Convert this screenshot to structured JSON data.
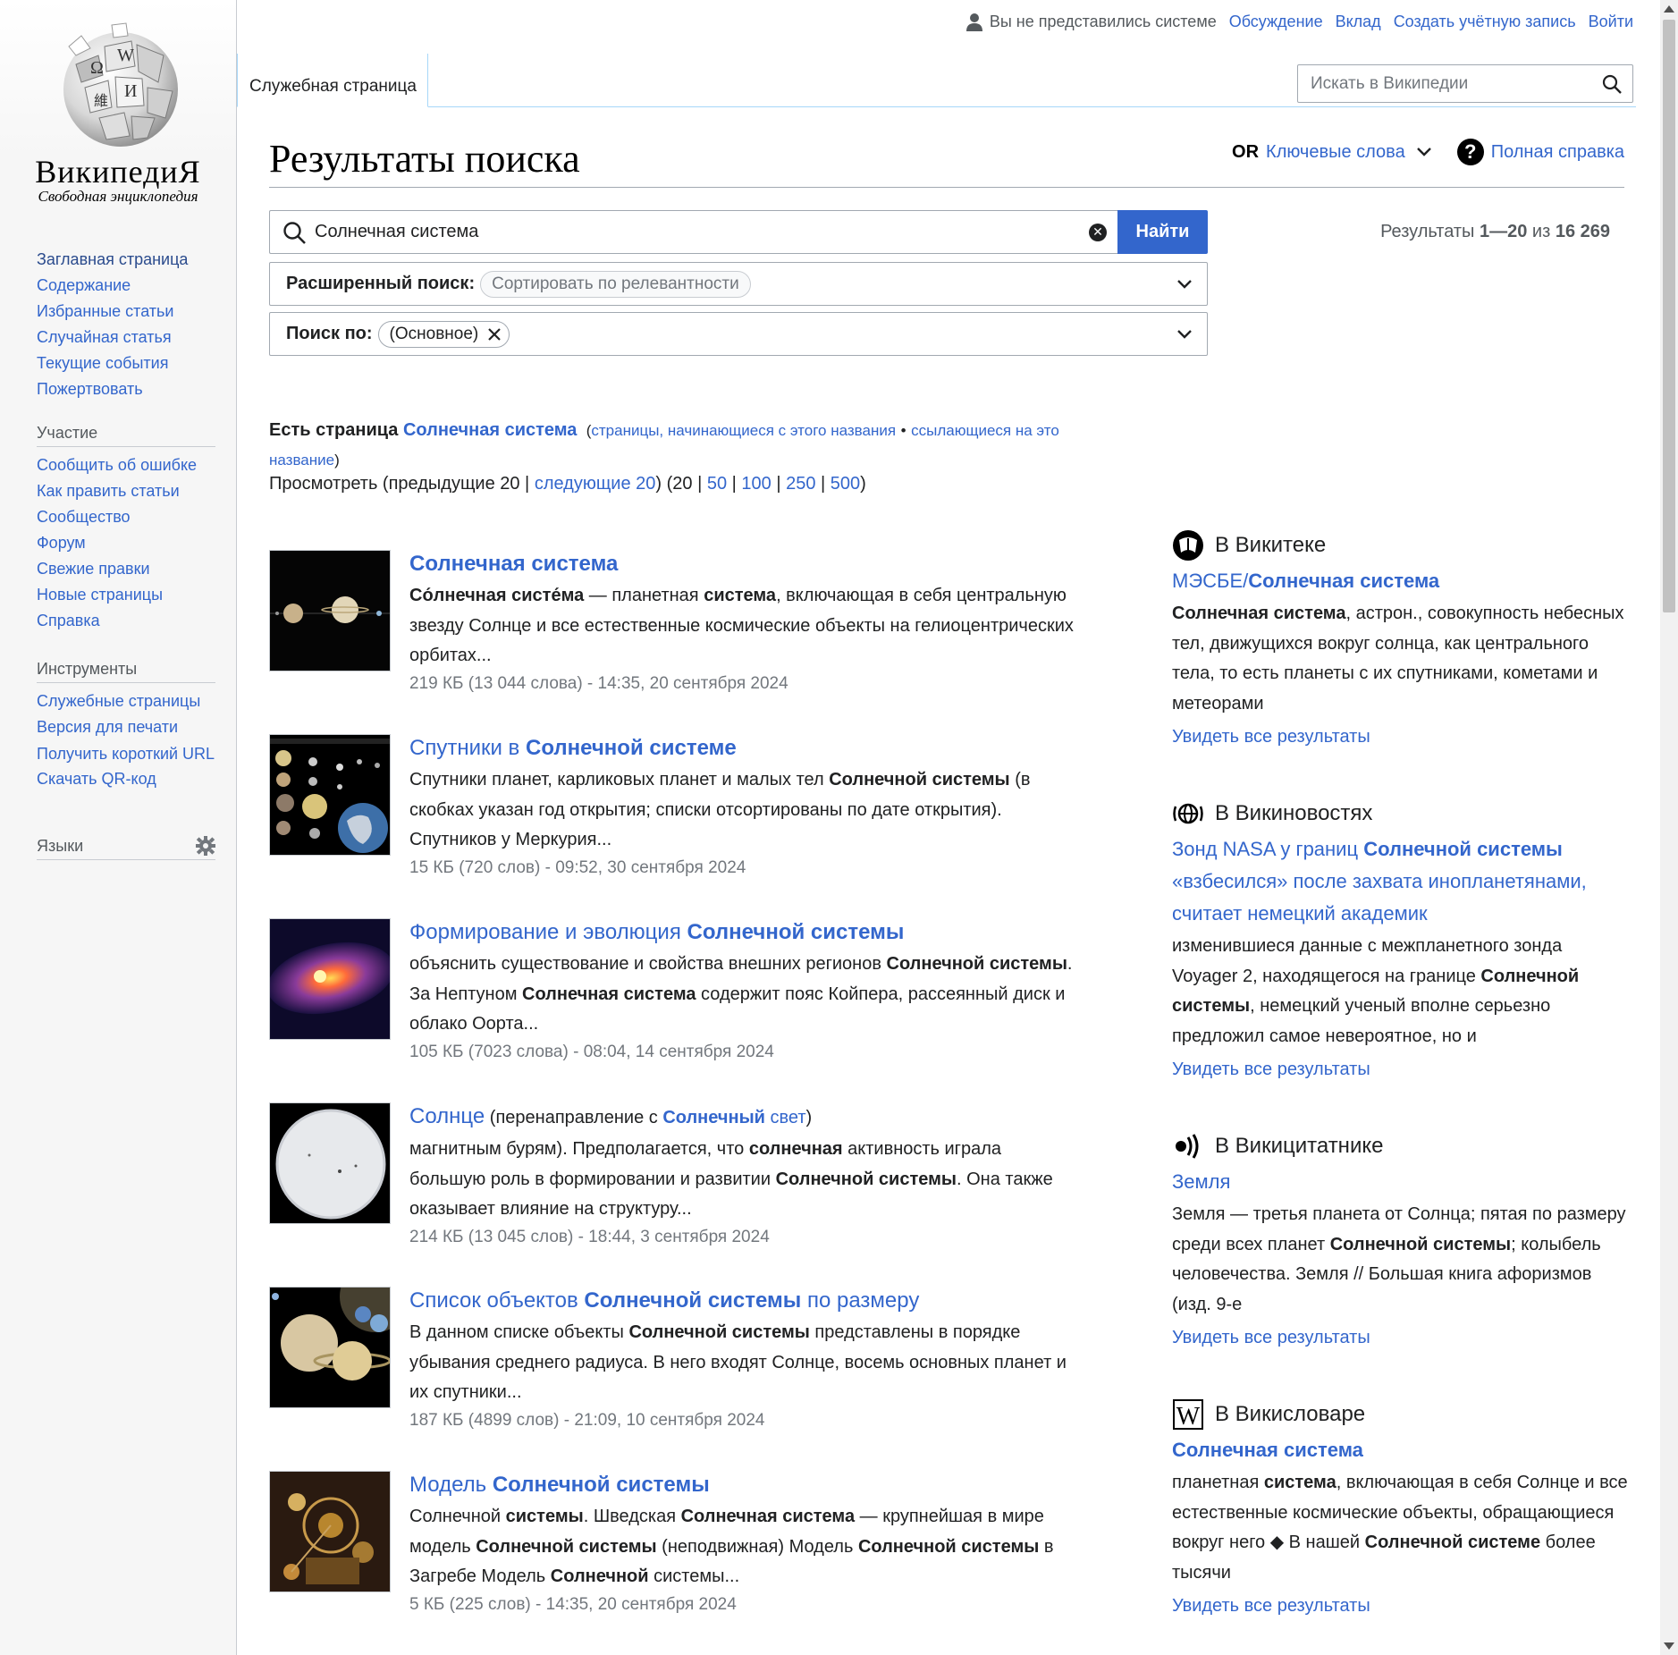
{
  "site": {
    "wordmark": "ВикипедиЯ",
    "tagline": "Свободная энциклопедия",
    "globe_letters": [
      "Ω",
      "W",
      "И",
      "維"
    ]
  },
  "header": {
    "anon_text": "Вы не представились системе",
    "links": [
      "Обсуждение",
      "Вклад",
      "Создать учётную запись",
      "Войти"
    ],
    "tab_special": "Служебная страница",
    "search_placeholder": "Искать в Википедии"
  },
  "sidebar": {
    "main": [
      "Заглавная страница",
      "Содержание",
      "Избранные статьи",
      "Случайная статья",
      "Текущие события",
      "Пожертвовать"
    ],
    "participation_heading": "Участие",
    "participation": [
      "Сообщить об ошибке",
      "Как править статьи",
      "Сообщество",
      "Форум",
      "Свежие правки",
      "Новые страницы",
      "Справка"
    ],
    "tools_heading": "Инструменты",
    "tools": [
      "Служебные страницы",
      "Версия для печати",
      "Получить короткий URL",
      "Скачать QR-код"
    ],
    "languages_heading": "Языки"
  },
  "page": {
    "title": "Результаты поиска",
    "or_label": "OR",
    "keywords_label": "Ключевые слова",
    "help_label": "Полная справка",
    "help_icon_glyph": "?",
    "query": "Солнечная система",
    "find_button": "Найти",
    "results_prefix": "Результаты",
    "results_range": "1—20",
    "results_of": "из",
    "results_total": "16 269",
    "advanced_label": "Расширенный поиск:",
    "advanced_chip": "Сортировать по релевантности",
    "search_in_label": "Поиск по:",
    "search_in_chip": "(Основное)",
    "exists_prefix": "Есть страница",
    "exists_link": "Солнечная система",
    "exists_sub1": "страницы, начинающиеся с этого названия",
    "exists_sep": "•",
    "exists_sub2": "ссылающиеся на это название",
    "view_prefix": "Просмотреть (предыдущие 20 |",
    "view_next": "следующие 20",
    "view_counts": [
      "50",
      "100",
      "250",
      "500"
    ],
    "view_current": "20"
  },
  "results": [
    {
      "title_parts": [
        {
          "t": "Солнечная система",
          "b": true
        }
      ],
      "snippet": "<b>Со́лнечная систе́ма</b> — планетная <b>система</b>, включающая в себя центральную звезду Солнце и все естественные космические объекты на гелиоцентрических орбитах...",
      "meta": "219 КБ (13 044 слова) - 14:35, 20 сентября 2024",
      "thumb": "planets"
    },
    {
      "title_parts": [
        {
          "t": "Спутники в ",
          "b": false
        },
        {
          "t": "Солнечной системе",
          "b": true
        }
      ],
      "snippet": "Спутники планет, карликовых планет и малых тел <b>Солнечной системы</b> (в скобках указан год открытия; списки отсортированы по дате открытия). Спутников у Меркурия...",
      "meta": "15 КБ (720 слов) - 09:52, 30 сентября 2024",
      "thumb": "moons"
    },
    {
      "title_parts": [
        {
          "t": "Формирование и эволюция ",
          "b": false
        },
        {
          "t": "Солнечной системы",
          "b": true
        }
      ],
      "snippet": "объяснить существование и свойства внешних регионов <b>Солнечной системы</b>. За Нептуном <b>Солнечная система</b> содержит пояс Койпера, рассеянный диск и облако Оорта...",
      "meta": "105 КБ (7023 слова) - 08:04, 14 сентября 2024",
      "thumb": "disk"
    },
    {
      "title_parts": [
        {
          "t": "Солнце",
          "b": false
        }
      ],
      "redirect_prefix": " (перенаправление с ",
      "redirect_parts": [
        {
          "t": "Солнечный",
          "b": true
        },
        {
          "t": " свет",
          "b": false
        }
      ],
      "redirect_suffix": ")",
      "snippet": "магнитным бурям). Предполагается, что <b>солнечная</b> активность играла большую роль в формировании и развитии <b>Солнечной системы</b>. Она также оказывает влияние на структуру...",
      "meta": "214 КБ (13 045 слов) - 18:44, 3 сентября 2024",
      "thumb": "sun"
    },
    {
      "title_parts": [
        {
          "t": "Список объектов ",
          "b": false
        },
        {
          "t": "Солнечной системы",
          "b": true
        },
        {
          "t": " по размеру",
          "b": false
        }
      ],
      "snippet": "В данном списке объекты <b>Солнечной системы</b> представлены в порядке убывания среднего радиуса. В него входят Солнце, восемь основных планет и их спутники...",
      "meta": "187 КБ (4899 слов) - 21:09, 10 сентября 2024",
      "thumb": "sizes"
    },
    {
      "title_parts": [
        {
          "t": "Модель ",
          "b": false
        },
        {
          "t": "Солнечной системы",
          "b": true
        }
      ],
      "snippet": "Солнечной <b>системы</b>. Шведская <b>Солнечная система</b> — крупнейшая в мире модель <b>Солнечной системы</b> (неподвижная) Модель <b>Солнечной системы</b> в Загребе Модель <b>Солнечной</b> системы...",
      "meta": "5 КБ (225 слов) - 14:35, 20 сентября 2024",
      "thumb": "orrery"
    }
  ],
  "sister": [
    {
      "project": "В Викитеке",
      "icon": "wikisource-icon",
      "title_html": "МЭСБЕ/<b>Солнечная система</b>",
      "snippet": "<b>Солнечная система</b>, астрон., совокупность небесных тел, движущихся вокруг солнца, как центрального тела, то есть планеты с их спутниками, кометами и метеорами",
      "more": "Увидеть все результаты"
    },
    {
      "project": "В Викиновостях",
      "icon": "wikinews-icon",
      "title_html": "Зонд NASA у границ <b>Солнечной системы</b> «взбесился» после захвата инопланетянами, считает немецкий академик",
      "snippet": "изменившиеся данные с межпланетного зонда Voyager 2, находящегося на границе <b>Солнечной системы</b>, немецкий ученый вполне серьезно предложил самое невероятное, но и",
      "more": "Увидеть все результаты"
    },
    {
      "project": "В Викицитатнике",
      "icon": "wikiquote-icon",
      "title_html": "Земля",
      "snippet": "Земля — третья планета от Солнца; пятая по размеру среди всех планет <b>Солнечной системы</b>; колыбель человечества. Земля // Большая книга афоризмов (изд. 9-е",
      "more": "Увидеть все результаты"
    },
    {
      "project": "В Викисловаре",
      "icon": "wiktionary-icon",
      "title_html": "<b>Солнечная система</b>",
      "snippet": "планетная <b>система</b>, включающая в себя Солнце и все естественные космические объекты, обращающиеся вокруг него ◆ В нашей <b>Солнечной системе</b> более тысячи",
      "more": "Увидеть все результаты"
    }
  ],
  "colors": {
    "link": "#3366cc",
    "button": "#3366cc",
    "text": "#202122",
    "meta": "#72777d"
  }
}
